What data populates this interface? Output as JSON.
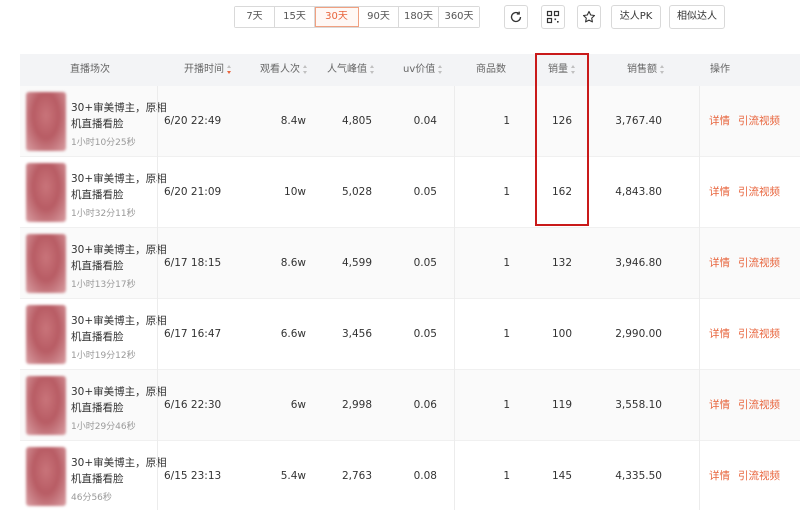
{
  "ranges": [
    "7天",
    "15天",
    "30天",
    "90天",
    "180天",
    "360天"
  ],
  "active_range": "30天",
  "toolbar": {
    "refresh_icon": "refresh-icon",
    "qr_icon": "qr-code-icon",
    "star_icon": "star-icon",
    "compare_label": "达人PK",
    "similar_label": "相似达人"
  },
  "table": {
    "headers": {
      "session": "直播场次",
      "start_time": "开播时间",
      "viewers": "观看人次",
      "peak": "人气峰值",
      "uv": "uv价值",
      "products": "商品数",
      "sales": "销量",
      "revenue": "销售额",
      "actions": "操作"
    },
    "rows": [
      {
        "title": "30+审美博主，原相机直播看脸",
        "duration": "1小时10分25秒",
        "start_time": "6/20 22:49",
        "viewers": "8.4w",
        "peak": "4,805",
        "uv": "0.04",
        "products": "1",
        "sales": "126",
        "revenue": "3,767.40"
      },
      {
        "title": "30+审美博主，原相机直播看脸",
        "duration": "1小时32分11秒",
        "start_time": "6/20 21:09",
        "viewers": "10w",
        "peak": "5,028",
        "uv": "0.05",
        "products": "1",
        "sales": "162",
        "revenue": "4,843.80"
      },
      {
        "title": "30+审美博主，原相机直播看脸",
        "duration": "1小时13分17秒",
        "start_time": "6/17 18:15",
        "viewers": "8.6w",
        "peak": "4,599",
        "uv": "0.05",
        "products": "1",
        "sales": "132",
        "revenue": "3,946.80"
      },
      {
        "title": "30+审美博主，原相机直播看脸",
        "duration": "1小时19分12秒",
        "start_time": "6/17 16:47",
        "viewers": "6.6w",
        "peak": "3,456",
        "uv": "0.05",
        "products": "1",
        "sales": "100",
        "revenue": "2,990.00"
      },
      {
        "title": "30+审美博主，原相机直播看脸",
        "duration": "1小时29分46秒",
        "start_time": "6/16 22:30",
        "viewers": "6w",
        "peak": "2,998",
        "uv": "0.06",
        "products": "1",
        "sales": "119",
        "revenue": "3,558.10"
      },
      {
        "title": "30+审美博主，原相机直播看脸",
        "duration": "46分56秒",
        "start_time": "6/15 23:13",
        "viewers": "5.4w",
        "peak": "2,763",
        "uv": "0.08",
        "products": "1",
        "sales": "145",
        "revenue": "4,335.50"
      }
    ],
    "action_detail": "详情",
    "action_video": "引流视频"
  },
  "colors": {
    "accent": "#e8643c",
    "highlight": "#c91a1a"
  }
}
